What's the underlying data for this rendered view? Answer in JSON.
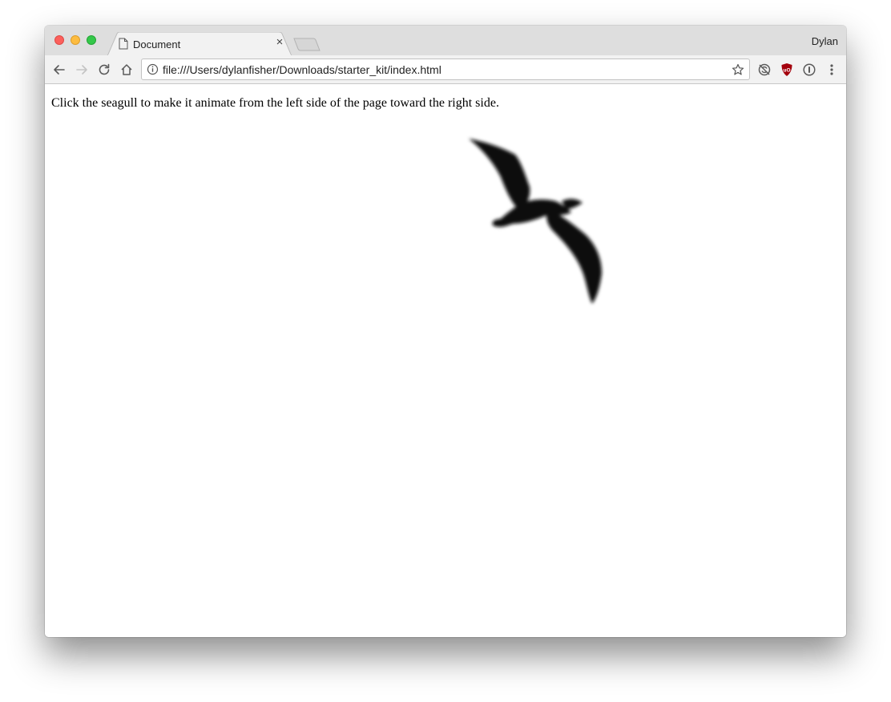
{
  "window": {
    "profile_name": "Dylan"
  },
  "tabs": [
    {
      "title": "Document",
      "icon": "document-icon",
      "close_icon": "close-icon",
      "close_glyph": "×"
    }
  ],
  "toolbar": {
    "back_icon": "back-arrow-icon",
    "forward_icon": "forward-arrow-icon",
    "reload_icon": "reload-icon",
    "home_icon": "home-icon",
    "address": {
      "value": "file:///Users/dylanfisher/Downloads/starter_kit/index.html",
      "info_icon": "info-icon",
      "bookmark_icon": "star-icon"
    },
    "extensions": [
      "sync-icon",
      "ublock-icon",
      "onepassword-icon"
    ],
    "menu_icon": "more-vert-icon"
  },
  "page": {
    "instructions": "Click the seagull to make it animate from the left side of the page toward the right side.",
    "image": "seagull"
  },
  "colors": {
    "traffic_close": "#fc605c",
    "traffic_minimize": "#fdbc40",
    "traffic_maximize": "#34c84a",
    "titlebar": "#dedede",
    "toolbar": "#f2f2f2",
    "ublock_red": "#a3000c"
  }
}
